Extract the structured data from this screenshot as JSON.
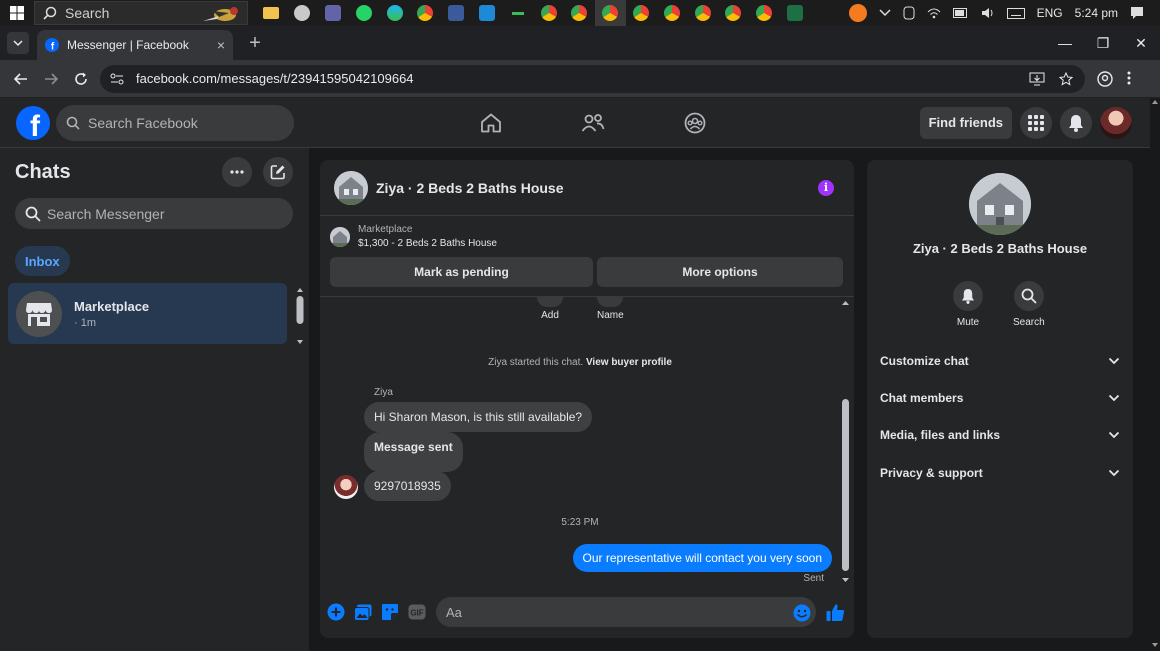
{
  "taskbar": {
    "search_label": "Search",
    "tray": {
      "language": "ENG",
      "clock": "5:24 pm"
    }
  },
  "browser": {
    "tab_title": "Messenger | Facebook",
    "tab_close": "×",
    "new_tab": "+",
    "url": "facebook.com/messages/t/23941595042109664",
    "window_controls": {
      "minimize": "—",
      "restore": "❐",
      "close": "✕"
    }
  },
  "fb_header": {
    "search_placeholder": "Search Facebook",
    "find_friends_label": "Find friends"
  },
  "sidebar": {
    "title": "Chats",
    "search_placeholder": "Search Messenger",
    "filter_chip": "Inbox",
    "chats": [
      {
        "name": "Marketplace",
        "time": "· 1m"
      }
    ]
  },
  "conversation": {
    "title": "Ziya · 2 Beds 2 Baths House",
    "marketplace": {
      "label": "Marketplace",
      "item": "$1,300 - 2 Beds 2 Baths House",
      "mark_pending_label": "Mark as pending",
      "more_options_label": "More options"
    },
    "quick_actions": {
      "add": "Add",
      "name": "Name"
    },
    "started_text": "Ziya started this chat.",
    "view_buyer_profile": "View buyer profile",
    "sender": "Ziya",
    "messages_in": [
      "Hi Sharon Mason, is this still available?",
      "Message sent",
      "9297018935"
    ],
    "time_divider": "5:23 PM",
    "message_out": "Our representative will contact you very soon",
    "sent_status": "Sent",
    "composer_placeholder": "Aa"
  },
  "info_panel": {
    "title": "Ziya · 2 Beds 2 Baths House",
    "mute_label": "Mute",
    "search_label": "Search",
    "sections": [
      "Customize chat",
      "Chat members",
      "Media, files and links",
      "Privacy & support"
    ]
  },
  "colors": {
    "accent_blue": "#0a7cff",
    "fb_blue": "#0866ff",
    "panel_bg": "#242526",
    "page_bg": "#18191a",
    "info_purple": "#a033ff"
  }
}
